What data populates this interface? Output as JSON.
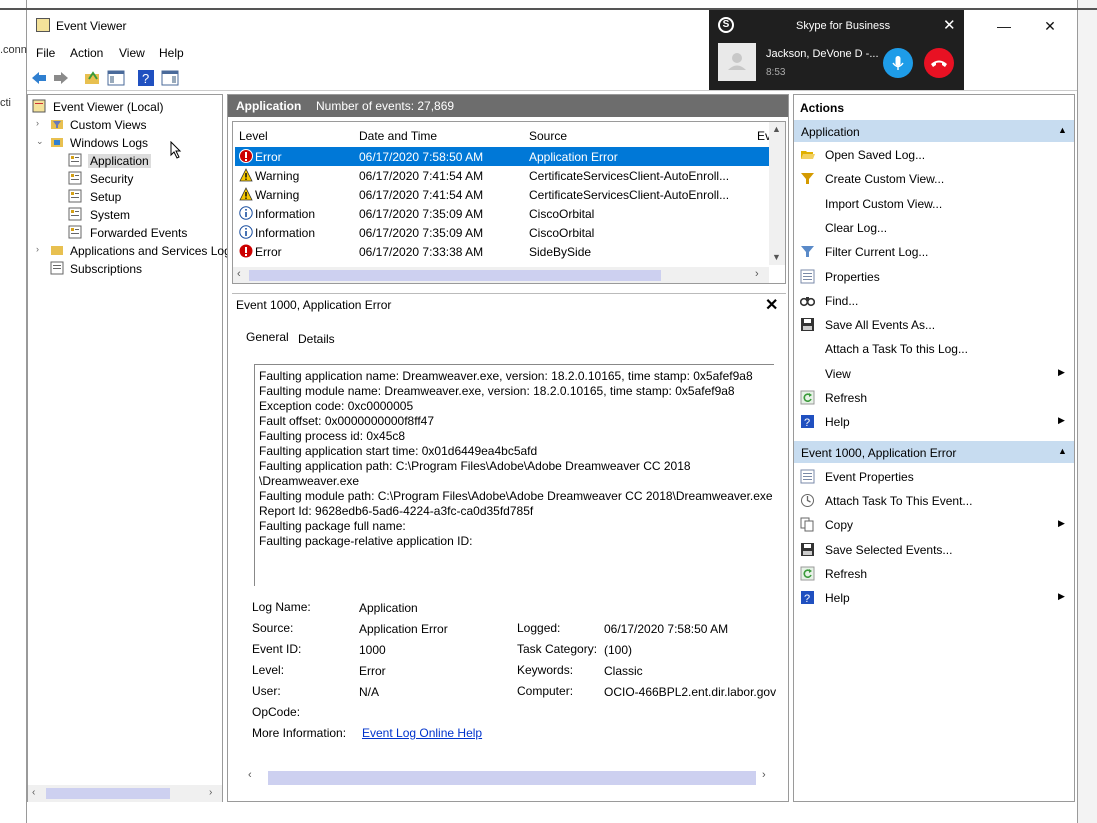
{
  "background": {
    "strip_text_1": ".conn",
    "strip_text_2": "cti"
  },
  "window": {
    "title": "Event Viewer",
    "minimize": "—",
    "maximize": "☐",
    "close": "✕"
  },
  "menu": [
    "File",
    "Action",
    "View",
    "Help"
  ],
  "tree": {
    "root": "Event Viewer (Local)",
    "custom_views": "Custom Views",
    "windows_logs": "Windows Logs",
    "logs": [
      "Application",
      "Security",
      "Setup",
      "System",
      "Forwarded Events"
    ],
    "apps_services": "Applications and Services Log",
    "subscriptions": "Subscriptions"
  },
  "center": {
    "header_title": "Application",
    "header_count": "Number of events: 27,869",
    "columns": [
      "Level",
      "Date and Time",
      "Source",
      "Ev"
    ],
    "rows": [
      {
        "level": "Error",
        "datetime": "06/17/2020 7:58:50 AM",
        "source": "Application Error",
        "icon": "error-icon",
        "selected": true
      },
      {
        "level": "Warning",
        "datetime": "06/17/2020 7:41:54 AM",
        "source": "CertificateServicesClient-AutoEnroll...",
        "icon": "warning-icon"
      },
      {
        "level": "Warning",
        "datetime": "06/17/2020 7:41:54 AM",
        "source": "CertificateServicesClient-AutoEnroll...",
        "icon": "warning-icon"
      },
      {
        "level": "Information",
        "datetime": "06/17/2020 7:35:09 AM",
        "source": "CiscoOrbital",
        "icon": "info-icon"
      },
      {
        "level": "Information",
        "datetime": "06/17/2020 7:35:09 AM",
        "source": "CiscoOrbital",
        "icon": "info-icon"
      },
      {
        "level": "Error",
        "datetime": "06/17/2020 7:33:38 AM",
        "source": "SideBySide",
        "icon": "error-icon"
      }
    ]
  },
  "detail": {
    "title": "Event 1000, Application Error",
    "close": "✕",
    "tabs": [
      "General",
      "Details"
    ],
    "description": [
      "Faulting application name: Dreamweaver.exe, version: 18.2.0.10165, time stamp: 0x5afef9a8",
      "Faulting module name: Dreamweaver.exe, version: 18.2.0.10165, time stamp: 0x5afef9a8",
      "Exception code: 0xc0000005",
      "Fault offset: 0x0000000000f8ff47",
      "Faulting process id: 0x45c8",
      "Faulting application start time: 0x01d6449ea4bc5afd",
      "Faulting application path: C:\\Program Files\\Adobe\\Adobe Dreamweaver CC 2018",
      "\\Dreamweaver.exe",
      "Faulting module path: C:\\Program Files\\Adobe\\Adobe Dreamweaver CC 2018\\Dreamweaver.exe",
      "Report Id: 9628edb6-5ad6-4224-a3fc-ca0d35fd785f",
      "Faulting package full name:",
      "Faulting package-relative application ID:"
    ],
    "props": {
      "log_name_label": "Log Name:",
      "log_name": "Application",
      "source_label": "Source:",
      "source": "Application Error",
      "logged_label": "Logged:",
      "logged": "06/17/2020 7:58:50 AM",
      "event_id_label": "Event ID:",
      "event_id": "1000",
      "task_label": "Task Category:",
      "task": "(100)",
      "level_label": "Level:",
      "level": "Error",
      "keywords_label": "Keywords:",
      "keywords": "Classic",
      "user_label": "User:",
      "user": "N/A",
      "computer_label": "Computer:",
      "computer": "OCIO-466BPL2.ent.dir.labor.gov",
      "opcode_label": "OpCode:",
      "opcode": "",
      "more_info_label": "More Information:",
      "more_info_link": "Event Log Online Help"
    }
  },
  "actions": {
    "title": "Actions",
    "section1": "Application",
    "section1_items": [
      {
        "label": "Open Saved Log...",
        "icon": "folder-open-icon",
        "color": "#e0b000"
      },
      {
        "label": "Create Custom View...",
        "icon": "filter-icon",
        "color": "#d49a00"
      },
      {
        "label": "Import Custom View...",
        "icon": "",
        "color": ""
      },
      {
        "label": "Clear Log...",
        "icon": "",
        "color": ""
      },
      {
        "label": "Filter Current Log...",
        "icon": "filter-icon",
        "color": "#5a8ac8"
      },
      {
        "label": "Properties",
        "icon": "properties-icon",
        "color": "#7a8aa8"
      },
      {
        "label": "Find...",
        "icon": "binoculars-icon",
        "color": "#333333"
      },
      {
        "label": "Save All Events As...",
        "icon": "save-icon",
        "color": "#333333"
      },
      {
        "label": "Attach a Task To this Log...",
        "icon": "",
        "color": ""
      },
      {
        "label": "View",
        "icon": "",
        "color": "",
        "submenu": true
      },
      {
        "label": "Refresh",
        "icon": "refresh-icon",
        "color": "#3a9a3a"
      },
      {
        "label": "Help",
        "icon": "help-icon",
        "color": "#2050c0",
        "submenu": true
      }
    ],
    "section2": "Event 1000, Application Error",
    "section2_items": [
      {
        "label": "Event Properties",
        "icon": "properties-icon",
        "color": "#7a8aa8"
      },
      {
        "label": "Attach Task To This Event...",
        "icon": "task-icon",
        "color": "#666666"
      },
      {
        "label": "Copy",
        "icon": "copy-icon",
        "color": "#666666",
        "submenu": true
      },
      {
        "label": "Save Selected Events...",
        "icon": "save-icon",
        "color": "#333333"
      },
      {
        "label": "Refresh",
        "icon": "refresh-icon",
        "color": "#3a9a3a"
      },
      {
        "label": "Help",
        "icon": "help-icon",
        "color": "#2050c0",
        "submenu": true
      }
    ]
  },
  "skype": {
    "title": "Skype for Business",
    "name": "Jackson, DeVone D -...",
    "time": "8:53",
    "close": "✕"
  }
}
